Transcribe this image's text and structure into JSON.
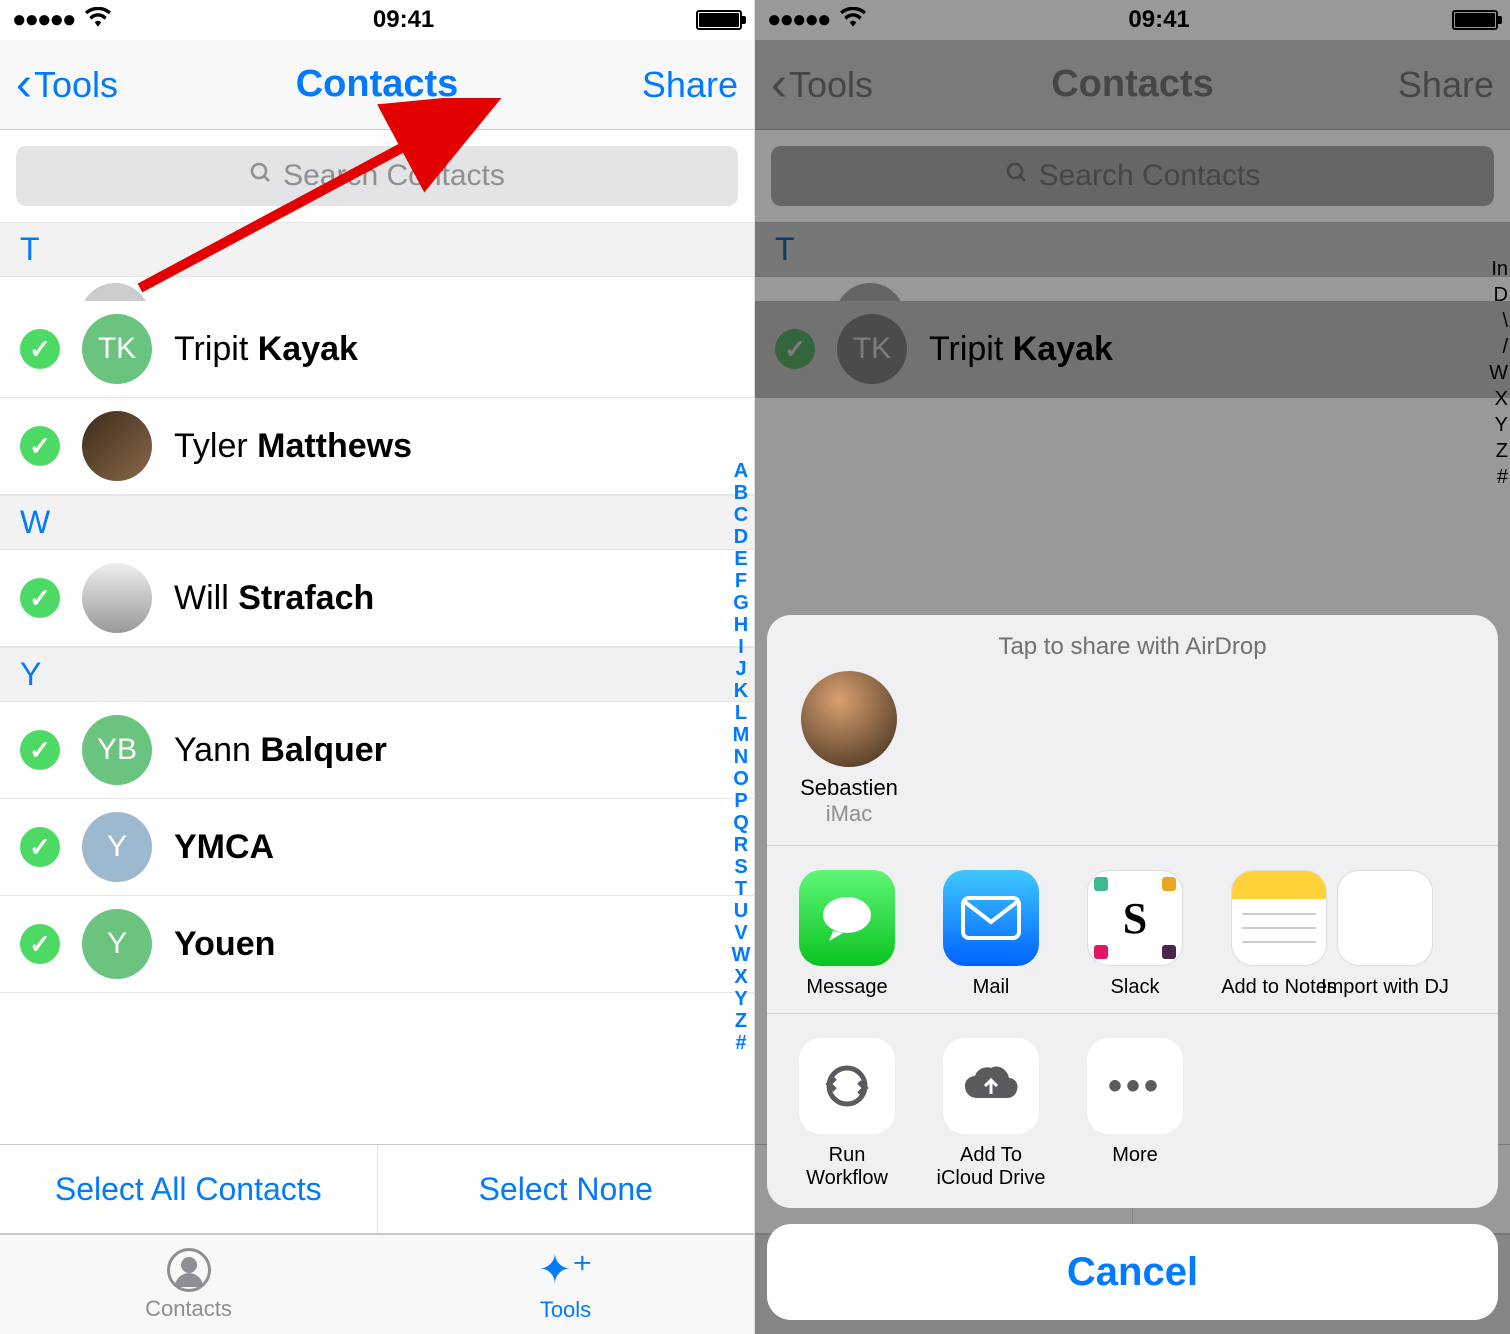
{
  "status": {
    "time": "09:41"
  },
  "nav": {
    "back": "Tools",
    "title": "Contacts",
    "share": "Share"
  },
  "search": {
    "placeholder": "Search Contacts"
  },
  "sections": {
    "t": "T",
    "w": "W",
    "y": "Y"
  },
  "contacts": {
    "tk": {
      "initials": "TK",
      "first": "Tripit ",
      "last": "Kayak"
    },
    "tm": {
      "first": "Tyler ",
      "last": "Matthews"
    },
    "ws": {
      "first": "Will ",
      "last": "Strafach"
    },
    "yb": {
      "initials": "YB",
      "first": "Yann ",
      "last": "Balquer"
    },
    "ym": {
      "initials": "Y",
      "name": "YMCA"
    },
    "yo": {
      "initials": "Y",
      "name": "Youen"
    }
  },
  "index_letters": [
    "A",
    "B",
    "C",
    "D",
    "E",
    "F",
    "G",
    "H",
    "I",
    "J",
    "K",
    "L",
    "M",
    "N",
    "O",
    "P",
    "Q",
    "R",
    "S",
    "T",
    "U",
    "V",
    "W",
    "X",
    "Y",
    "Z",
    "#"
  ],
  "select": {
    "all": "Select All Contacts",
    "none": "Select None"
  },
  "tabs": {
    "contacts": "Contacts",
    "tools": "Tools"
  },
  "sheet": {
    "title": "Tap to share with AirDrop",
    "airdrop": {
      "name": "Sebastien",
      "device": "iMac"
    },
    "apps": {
      "message": "Message",
      "mail": "Mail",
      "slack": "Slack",
      "notes": "Add to Notes",
      "import": "Import with DJ"
    },
    "actions": {
      "workflow": "Run Workflow",
      "icloud": "Add To iCloud Drive",
      "more": "More"
    },
    "cancel": "Cancel"
  },
  "partial_under": {
    "all": "Select All Contacts",
    "none": "Select None",
    "tools": "Tools"
  }
}
